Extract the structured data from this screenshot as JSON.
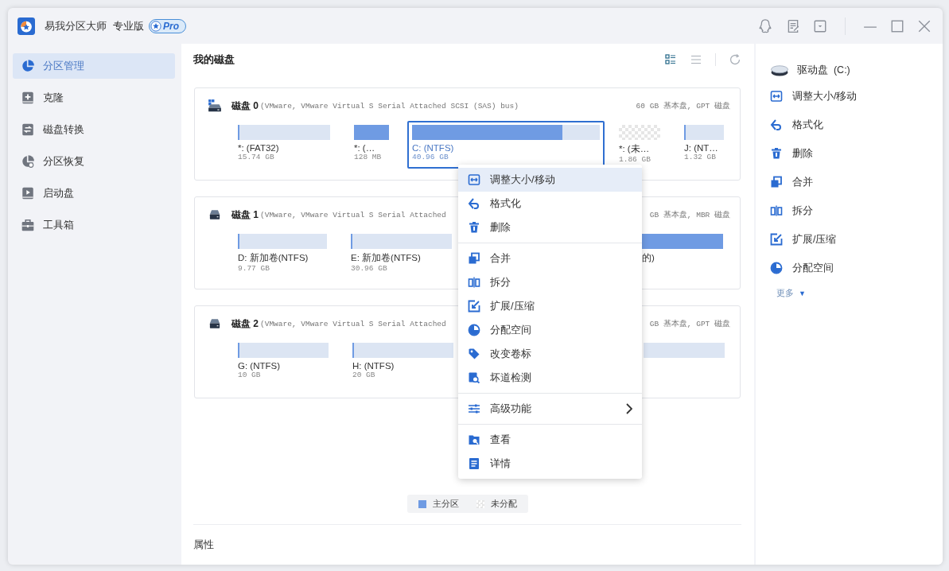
{
  "app": {
    "name": "易我分区大师",
    "edition": "专业版",
    "badge": "Pro"
  },
  "sidebar": {
    "items": [
      {
        "label": "分区管理",
        "selected": true
      },
      {
        "label": "克隆",
        "selected": false
      },
      {
        "label": "磁盘转换",
        "selected": false
      },
      {
        "label": "分区恢复",
        "selected": false
      },
      {
        "label": "启动盘",
        "selected": false
      },
      {
        "label": "工具箱",
        "selected": false
      }
    ]
  },
  "main": {
    "title": "我的磁盘",
    "view_modes": [
      {
        "kind": "cards",
        "selected": true
      },
      {
        "kind": "list",
        "selected": false
      }
    ]
  },
  "disks": [
    {
      "name": "磁盘 0",
      "model": "(VMware,  VMware Virtual S Serial Attached SCSI (SAS) bus)",
      "summary": "60 GB 基本盘, GPT 磁盘",
      "partitions": [
        {
          "kind": "partition",
          "label": "*: (FAT32)",
          "size": "15.74 GB",
          "level": 0.01,
          "selected": false
        },
        {
          "kind": "partition",
          "label": "*: (…",
          "size": "128 MB",
          "level": 1,
          "selected": false
        },
        {
          "kind": "partition",
          "label": "C: (NTFS)",
          "size": "40.96 GB",
          "level": 0.8,
          "selected": true
        },
        {
          "kind": "unallocated",
          "label": "*: (未…",
          "size": "1.86 GB",
          "selected": false
        },
        {
          "kind": "partition",
          "label": "J: (NT…",
          "size": "1.32 GB",
          "level": 0.02,
          "selected": false
        }
      ]
    },
    {
      "name": "磁盘 1",
      "model": "(VMware,  VMware Virtual S Serial Attached",
      "summary": "GB 基本盘, MBR 磁盘",
      "partitions": [
        {
          "kind": "partition",
          "label": "D: 新加卷(NTFS)",
          "size": "9.77 GB",
          "level": 0.01,
          "selected": false
        },
        {
          "kind": "partition",
          "label": "E: 新加卷(NTFS)",
          "size": "30.96 GB",
          "level": 0.01,
          "selected": false
        },
        {
          "kind": "partition",
          "label": "的)",
          "level": 1,
          "selected": false
        }
      ]
    },
    {
      "name": "磁盘 2",
      "model": "(VMware,  VMware Virtual S Serial Attached",
      "summary": "GB 基本盘, GPT 磁盘",
      "partitions": [
        {
          "kind": "partition",
          "label": "G: (NTFS)",
          "size": "10 GB",
          "level": 0.01,
          "selected": false
        },
        {
          "kind": "partition",
          "label": "H: (NTFS)",
          "size": "20 GB",
          "level": 0.01,
          "selected": false
        },
        {
          "kind": "partition",
          "selected": false
        }
      ]
    }
  ],
  "context_menu": {
    "groups": [
      [
        {
          "label": "调整大小/移动",
          "selected": true,
          "submenu": false
        },
        {
          "label": "格式化",
          "selected": false,
          "submenu": false
        },
        {
          "label": "删除",
          "selected": false,
          "submenu": false
        }
      ],
      [
        {
          "label": "合并",
          "selected": false,
          "submenu": false
        },
        {
          "label": "拆分",
          "selected": false,
          "submenu": false
        },
        {
          "label": "扩展/压缩",
          "selected": false,
          "submenu": false
        },
        {
          "label": "分配空间",
          "selected": false,
          "submenu": false
        },
        {
          "label": "改变卷标",
          "selected": false,
          "submenu": false
        },
        {
          "label": "坏道检测",
          "selected": false,
          "submenu": false
        }
      ],
      [
        {
          "label": "高级功能",
          "selected": false,
          "submenu": true
        }
      ],
      [
        {
          "label": "查看",
          "selected": false,
          "submenu": false
        },
        {
          "label": "详情",
          "selected": false,
          "submenu": false
        }
      ]
    ]
  },
  "legend": [
    {
      "kind": "primary",
      "label": "主分区"
    },
    {
      "kind": "unallocated",
      "label": "未分配"
    }
  ],
  "properties": {
    "title": "属性"
  },
  "action_panel": {
    "drive": "驱动盘  (C:)",
    "actions": [
      "调整大小/移动",
      "格式化",
      "删除",
      "合并",
      "拆分",
      "扩展/压缩",
      "分配空间"
    ],
    "more": {
      "label": "更多",
      "caret": "▼"
    }
  }
}
